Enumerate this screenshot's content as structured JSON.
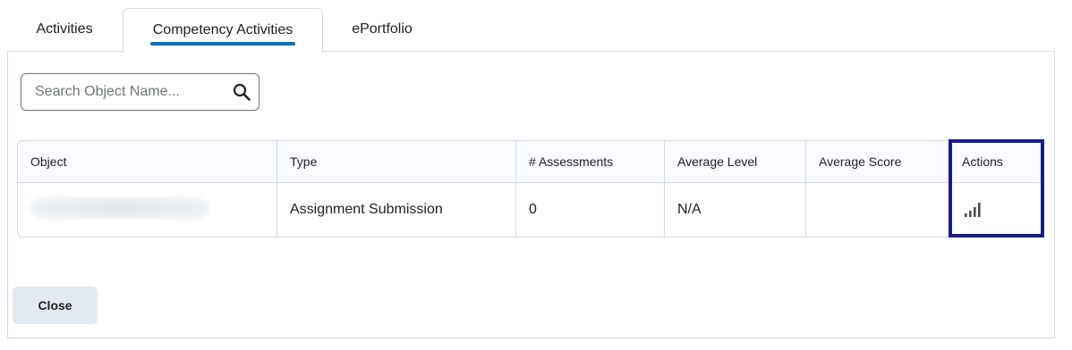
{
  "tabs": [
    {
      "label": "Activities",
      "selected": false
    },
    {
      "label": "Competency Activities",
      "selected": true
    },
    {
      "label": "ePortfolio",
      "selected": false
    }
  ],
  "search": {
    "placeholder": "Search Object Name...",
    "value": "",
    "icon": "search-icon"
  },
  "table": {
    "columns": [
      "Object",
      "Type",
      "# Assessments",
      "Average Level",
      "Average Score",
      "Actions"
    ],
    "rows": [
      {
        "object": "",
        "type": "Assignment Submission",
        "assessments": "0",
        "average_level": "N/A",
        "average_score": "",
        "action_icon": "bar-chart-icon"
      }
    ]
  },
  "footer": {
    "close_label": "Close"
  },
  "colors": {
    "accent": "#006fbf",
    "highlight_border": "#1a1a8c",
    "border": "#d3d9e3",
    "header_bg": "#f9fbff",
    "button_bg": "#e3e9f1"
  }
}
